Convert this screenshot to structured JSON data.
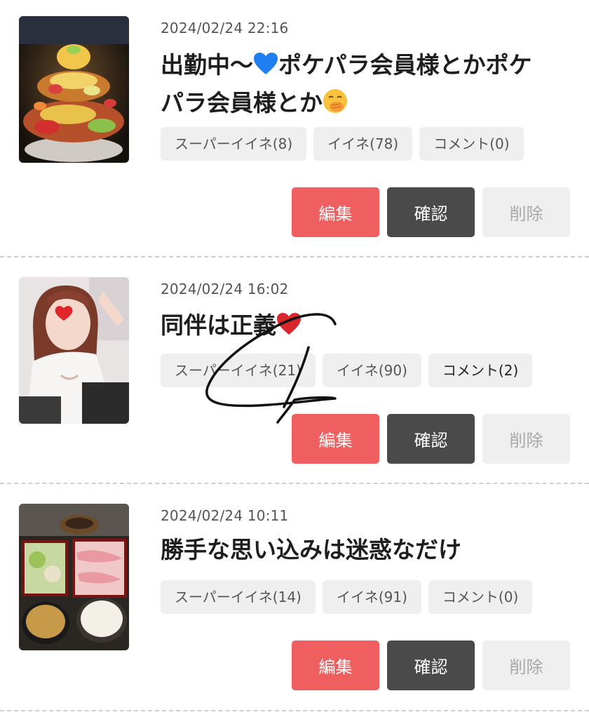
{
  "posts": [
    {
      "date": "2024/02/24 22:16",
      "title_line1_pre": "出勤中〜",
      "title_line1_post": "ポケパラ会員様とかポケ",
      "title_line2": "パラ会員様とか",
      "tags": {
        "super_like": "スーパーイイネ(8)",
        "like": "イイネ(78)",
        "comment": "コメント(0)"
      },
      "buttons": {
        "edit": "編集",
        "confirm": "確認",
        "delete": "削除"
      }
    },
    {
      "date": "2024/02/24 16:02",
      "title": "同伴は正義",
      "tags": {
        "super_like": "スーパーイイネ(21)",
        "like": "イイネ(90)",
        "comment": "コメント(2)"
      },
      "buttons": {
        "edit": "編集",
        "confirm": "確認",
        "delete": "削除"
      }
    },
    {
      "date": "2024/02/24 10:11",
      "title": "勝手な思い込みは迷惑なだけ",
      "tags": {
        "super_like": "スーパーイイネ(14)",
        "like": "イイネ(91)",
        "comment": "コメント(0)"
      },
      "buttons": {
        "edit": "編集",
        "confirm": "確認",
        "delete": "削除"
      }
    }
  ],
  "icons": {
    "post1_title_emoji_1": "blue-heart-icon",
    "post1_title_emoji_2": "face-with-hand-over-mouth-icon",
    "post2_title_emoji": "red-heart-icon"
  },
  "colors": {
    "edit": "#ef5f5f",
    "confirm": "#4a4a4a",
    "delete": "#efefef",
    "tag_bg": "#efefef"
  }
}
